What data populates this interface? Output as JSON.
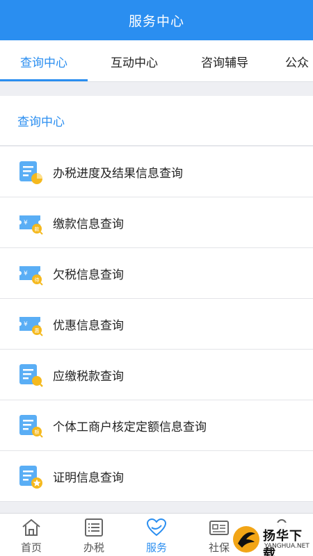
{
  "header": {
    "title": "服务中心"
  },
  "tabs": [
    {
      "label": "查询中心",
      "active": true
    },
    {
      "label": "互动中心"
    },
    {
      "label": "咨询辅导"
    },
    {
      "label": "公众"
    }
  ],
  "section": {
    "title": "查询中心"
  },
  "items": [
    {
      "label": "办税进度及结果信息查询",
      "icon": "document-pie-icon"
    },
    {
      "label": "缴款信息查询",
      "icon": "ticket-payment-icon",
      "badge": "款"
    },
    {
      "label": "欠税信息查询",
      "icon": "ticket-arrears-icon",
      "badge": "待"
    },
    {
      "label": "优惠信息查询",
      "icon": "ticket-discount-icon",
      "badge": "惠"
    },
    {
      "label": "应缴税款查询",
      "icon": "document-search-icon"
    },
    {
      "label": "个体工商户核定定额信息查询",
      "icon": "document-quota-icon",
      "badge": "额"
    },
    {
      "label": "证明信息查询",
      "icon": "document-star-icon"
    }
  ],
  "bottom_nav": [
    {
      "label": "首页",
      "icon": "home-icon"
    },
    {
      "label": "办税",
      "icon": "list-icon"
    },
    {
      "label": "服务",
      "icon": "heart-icon",
      "active": true
    },
    {
      "label": "社保",
      "icon": "id-card-icon"
    },
    {
      "label": "",
      "icon": "user-icon"
    }
  ],
  "watermark": {
    "title": "扬华下载",
    "subtitle": "YANGHUA.NET"
  },
  "colors": {
    "primary": "#2a8ef0",
    "icon_blue": "#5aaef5",
    "icon_yellow": "#f5b91e",
    "text": "#222222",
    "background": "#eeeff3"
  }
}
